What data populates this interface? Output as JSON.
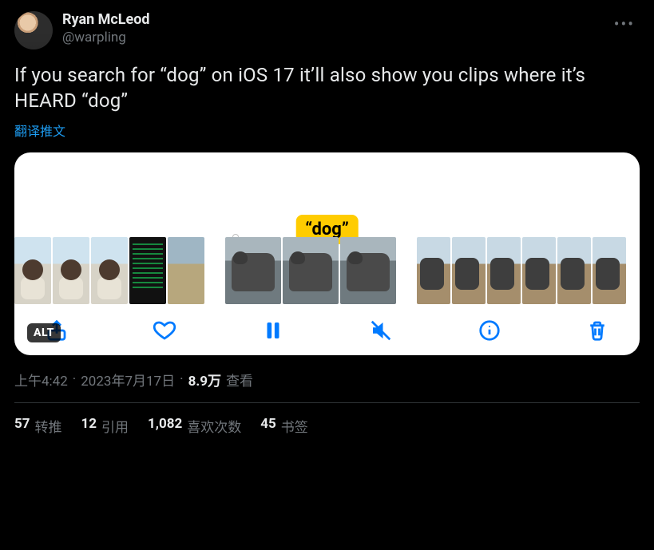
{
  "author": {
    "display_name": "Ryan McLeod",
    "handle": "@warpling"
  },
  "tweet_text": "If you search for “dog” on iOS 17 it’ll also show you clips where it’s HEARD “dog”",
  "translate_label": "翻译推文",
  "media": {
    "alt_badge": "ALT",
    "search_tag": "“dog”",
    "toolbar": {
      "share": "share",
      "like": "like",
      "pause": "pause",
      "mute": "muted",
      "info": "info",
      "delete": "delete"
    }
  },
  "meta": {
    "time": "上午4:42",
    "sep1": " · ",
    "date": "2023年7月17日",
    "sep2": " · ",
    "views_num": "8.9万",
    "views_label": " 查看"
  },
  "stats": {
    "retweets_num": "57",
    "retweets_label": "转推",
    "quotes_num": "12",
    "quotes_label": "引用",
    "likes_num": "1,082",
    "likes_label": "喜欢次数",
    "bookmarks_num": "45",
    "bookmarks_label": "书签"
  }
}
